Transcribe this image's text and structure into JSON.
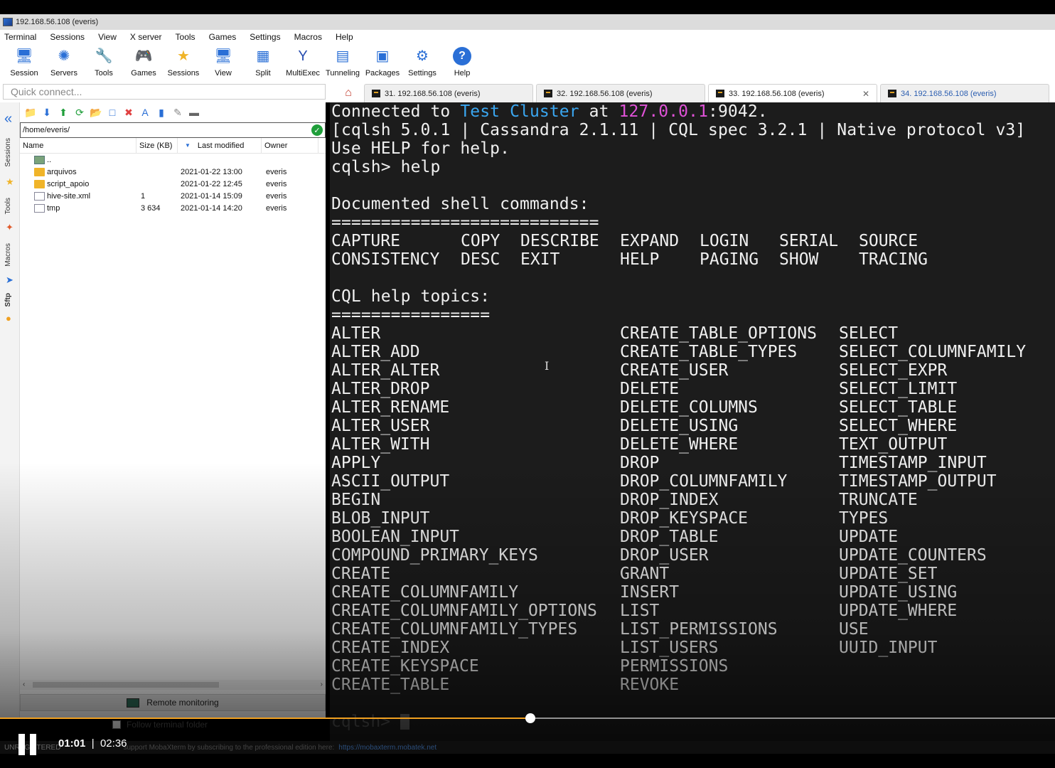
{
  "window": {
    "title": "192.168.56.108 (everis)"
  },
  "menu": [
    "Terminal",
    "Sessions",
    "View",
    "X server",
    "Tools",
    "Games",
    "Settings",
    "Macros",
    "Help"
  ],
  "toolbar": [
    {
      "label": "Session",
      "icon": "session-icon"
    },
    {
      "label": "Servers",
      "icon": "servers-icon"
    },
    {
      "label": "Tools",
      "icon": "tools-icon"
    },
    {
      "label": "Games",
      "icon": "games-icon"
    },
    {
      "label": "Sessions",
      "icon": "star-icon"
    },
    {
      "label": "View",
      "icon": "view-icon"
    },
    {
      "label": "Split",
      "icon": "split-icon"
    },
    {
      "label": "MultiExec",
      "icon": "multiexec-icon"
    },
    {
      "label": "Tunneling",
      "icon": "tunneling-icon"
    },
    {
      "label": "Packages",
      "icon": "packages-icon"
    },
    {
      "label": "Settings",
      "icon": "gears-icon"
    },
    {
      "label": "Help",
      "icon": "help-icon"
    }
  ],
  "quick_connect": {
    "placeholder": "Quick connect..."
  },
  "tabs": [
    {
      "label": "31. 192.168.56.108 (everis)"
    },
    {
      "label": "32. 192.168.56.108 (everis)"
    },
    {
      "label": "33. 192.168.56.108 (everis)",
      "active": true
    },
    {
      "label": "34. 192.168.56.108 (everis)"
    }
  ],
  "side_tabs": [
    "Sessions",
    "Tools",
    "Macros",
    "Sftp"
  ],
  "sftp": {
    "path": "/home/everis/",
    "columns": [
      "Name",
      "Size (KB)",
      "Last modified",
      "Owner"
    ],
    "files": [
      {
        "name": "..",
        "size": "",
        "modified": "",
        "owner": "",
        "kind": "up"
      },
      {
        "name": "arquivos",
        "size": "",
        "modified": "2021-01-22 13:00",
        "owner": "everis",
        "kind": "folder"
      },
      {
        "name": "script_apoio",
        "size": "",
        "modified": "2021-01-22 12:45",
        "owner": "everis",
        "kind": "folder"
      },
      {
        "name": "hive-site.xml",
        "size": "1",
        "modified": "2021-01-14 15:09",
        "owner": "everis",
        "kind": "file"
      },
      {
        "name": "tmp",
        "size": "3 634",
        "modified": "2021-01-14 14:20",
        "owner": "everis",
        "kind": "file"
      }
    ],
    "remote_monitoring": "Remote monitoring",
    "follow_terminal": "Follow terminal folder"
  },
  "terminal": {
    "connected_prefix": "Connected to ",
    "cluster": "Test Cluster",
    "at": " at ",
    "host": "127.0.0.1",
    "port": ":9042.",
    "version_line": "[cqlsh 5.0.1 | Cassandra 2.1.11 | CQL spec 3.2.1 | Native protocol v3]",
    "help_hint": "Use HELP for help.",
    "command": "cqlsh> help",
    "documented_header": "Documented shell commands:",
    "documented_rule": "===========================",
    "shell_row1": [
      "CAPTURE",
      "COPY",
      "DESCRIBE",
      "EXPAND",
      "LOGIN",
      "SERIAL",
      "SOURCE"
    ],
    "shell_row2": [
      "CONSISTENCY",
      "DESC",
      "EXIT",
      "HELP",
      "PAGING",
      "SHOW",
      "TRACING"
    ],
    "cql_header": "CQL help topics:",
    "cql_rule": "================",
    "cql_col1": [
      "ALTER",
      "ALTER_ADD",
      "ALTER_ALTER",
      "ALTER_DROP",
      "ALTER_RENAME",
      "ALTER_USER",
      "ALTER_WITH",
      "APPLY",
      "ASCII_OUTPUT",
      "BEGIN",
      "BLOB_INPUT",
      "BOOLEAN_INPUT",
      "COMPOUND_PRIMARY_KEYS",
      "CREATE",
      "CREATE_COLUMNFAMILY",
      "CREATE_COLUMNFAMILY_OPTIONS",
      "CREATE_COLUMNFAMILY_TYPES",
      "CREATE_INDEX",
      "CREATE_KEYSPACE",
      "CREATE_TABLE"
    ],
    "cql_col2": [
      "CREATE_TABLE_OPTIONS",
      "CREATE_TABLE_TYPES",
      "CREATE_USER",
      "DELETE",
      "DELETE_COLUMNS",
      "DELETE_USING",
      "DELETE_WHERE",
      "DROP",
      "DROP_COLUMNFAMILY",
      "DROP_INDEX",
      "DROP_KEYSPACE",
      "DROP_TABLE",
      "DROP_USER",
      "GRANT",
      "INSERT",
      "LIST",
      "LIST_PERMISSIONS",
      "LIST_USERS",
      "PERMISSIONS",
      "REVOKE"
    ],
    "cql_col3": [
      "SELECT",
      "SELECT_COLUMNFAMILY",
      "SELECT_EXPR",
      "SELECT_LIMIT",
      "SELECT_TABLE",
      "SELECT_WHERE",
      "TEXT_OUTPUT",
      "TIMESTAMP_INPUT",
      "TIMESTAMP_OUTPUT",
      "TRUNCATE",
      "TYPES",
      "UPDATE",
      "UPDATE_COUNTERS",
      "UPDATE_SET",
      "UPDATE_USING",
      "UPDATE_WHERE",
      "USE",
      "UUID_INPUT"
    ],
    "prompt": "cqlsh> "
  },
  "status": {
    "left": "UNREGISTERED",
    "message": "support MobaXterm by subscribing to the professional edition here:",
    "link": "https://mobaxterm.mobatek.net"
  },
  "video": {
    "current": "01:01",
    "separator": "|",
    "total": "02:36",
    "progress": 0.503
  },
  "colors": {
    "terminal_bg": "#1c1c1c",
    "cluster": "#3aa6f0",
    "host": "#e052d8",
    "progress": "#f0a020"
  }
}
